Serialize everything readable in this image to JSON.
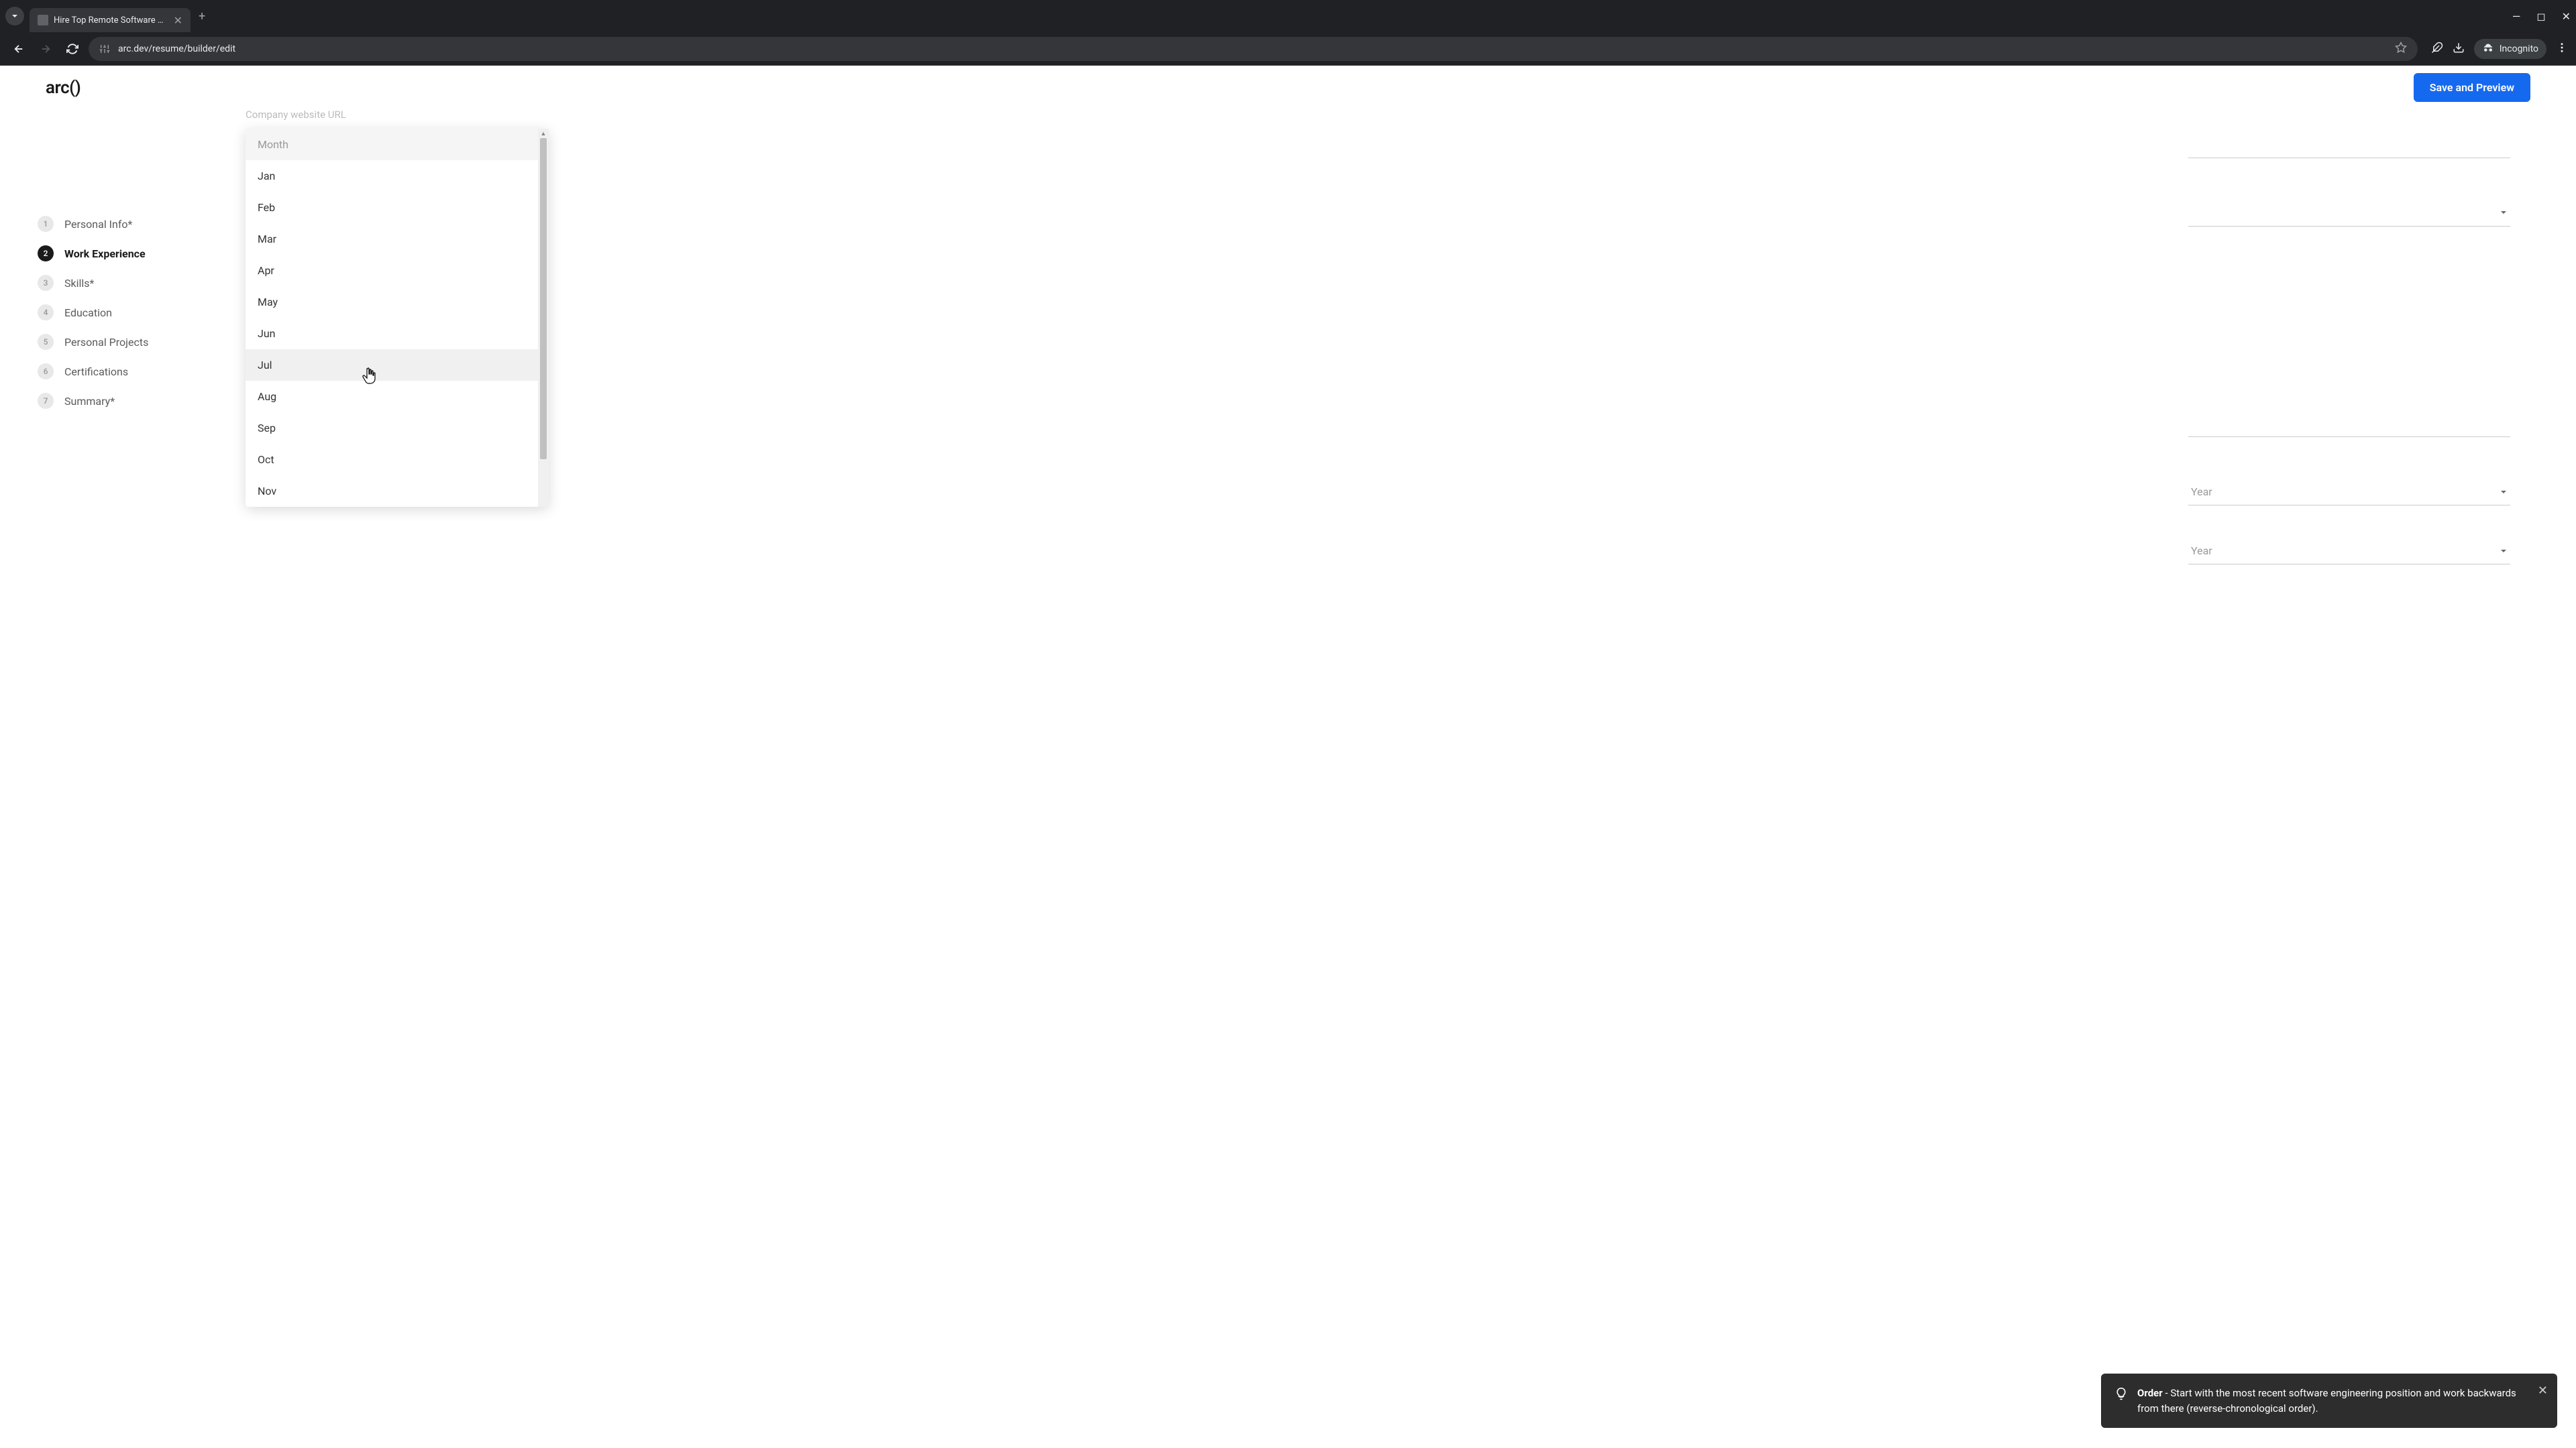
{
  "browser": {
    "tab_title": "Hire Top Remote Software Dev",
    "url": "arc.dev/resume/builder/edit",
    "incognito_label": "Incognito"
  },
  "header": {
    "logo": "arc()",
    "save_button": "Save and Preview"
  },
  "sidebar": {
    "steps": [
      {
        "num": "1",
        "label": "Personal Info*"
      },
      {
        "num": "2",
        "label": "Work Experience"
      },
      {
        "num": "3",
        "label": "Skills*"
      },
      {
        "num": "4",
        "label": "Education"
      },
      {
        "num": "5",
        "label": "Personal Projects"
      },
      {
        "num": "6",
        "label": "Certifications"
      },
      {
        "num": "7",
        "label": "Summary*"
      }
    ]
  },
  "form": {
    "faded_label": "Company website URL",
    "year_placeholder_1": "Year",
    "year_placeholder_2": "Year"
  },
  "dropdown": {
    "header": "Month",
    "items": [
      "Jan",
      "Feb",
      "Mar",
      "Apr",
      "May",
      "Jun",
      "Jul",
      "Aug",
      "Sep",
      "Oct",
      "Nov"
    ]
  },
  "toast": {
    "title": "Order",
    "message": " - Start with the most recent software engineering position and work backwards from there (reverse-chronological order)."
  }
}
